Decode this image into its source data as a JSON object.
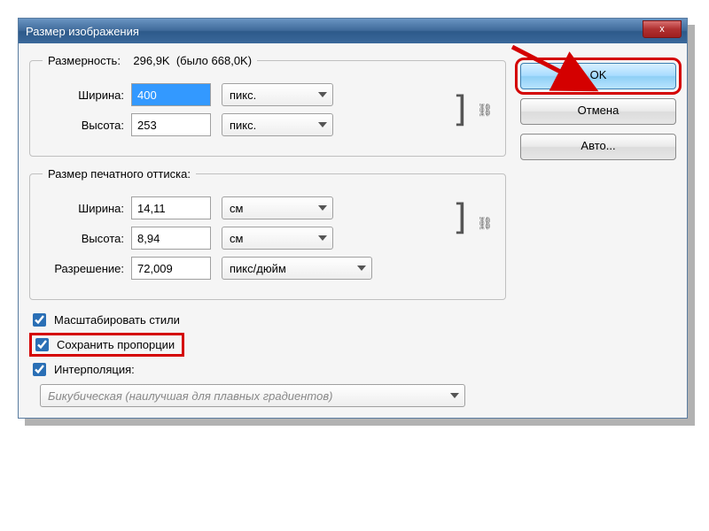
{
  "window": {
    "title": "Размер изображения",
    "close": "x"
  },
  "pixelDims": {
    "legendPrefix": "Размерность:",
    "size": "296,9K",
    "sizeWas": "(было 668,0K)",
    "widthLabel": "Ширина:",
    "width": "400",
    "widthUnit": "пикс.",
    "heightLabel": "Высота:",
    "height": "253",
    "heightUnit": "пикс."
  },
  "printDims": {
    "legend": "Размер печатного оттиска:",
    "widthLabel": "Ширина:",
    "width": "14,11",
    "widthUnit": "см",
    "heightLabel": "Высота:",
    "height": "8,94",
    "heightUnit": "см",
    "resLabel": "Разрешение:",
    "res": "72,009",
    "resUnit": "пикс/дюйм"
  },
  "checks": {
    "scaleStyles": "Масштабировать стили",
    "constrain": "Сохранить пропорции",
    "interp": "Интерполяция:"
  },
  "interpMethod": "Бикубическая (наилучшая для плавных градиентов)",
  "buttons": {
    "ok": "OK",
    "cancel": "Отмена",
    "auto": "Авто..."
  },
  "icons": {
    "link": "⛓"
  }
}
